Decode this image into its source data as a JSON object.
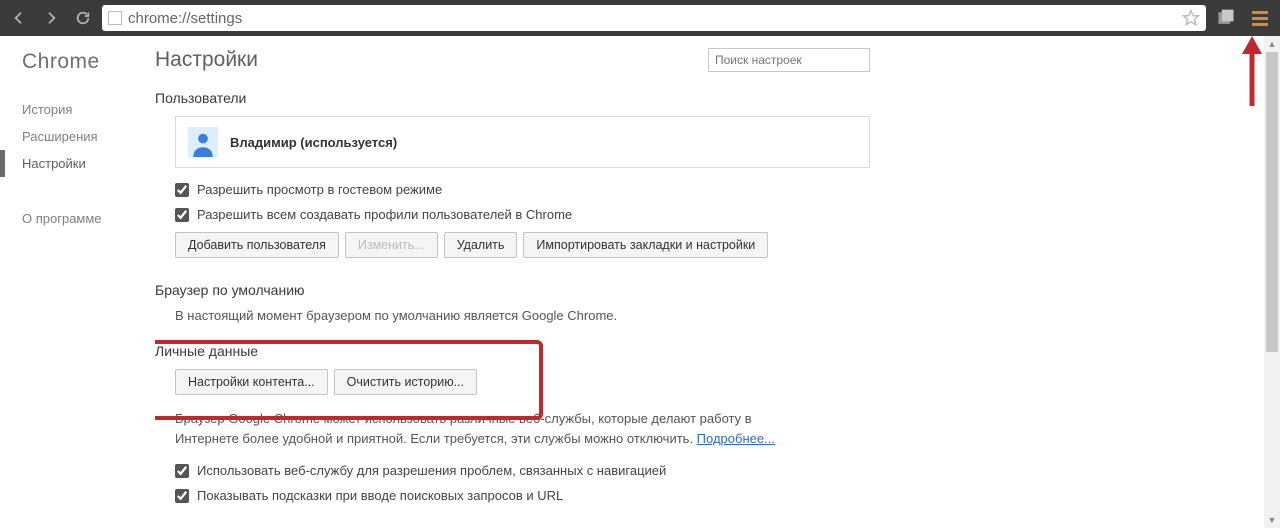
{
  "chrome_bar": {
    "url": "chrome://settings"
  },
  "sidebar": {
    "title": "Chrome",
    "items": [
      {
        "label": "История",
        "active": false
      },
      {
        "label": "Расширения",
        "active": false
      },
      {
        "label": "Настройки",
        "active": true
      }
    ],
    "about": "О программе"
  },
  "header": {
    "title": "Настройки",
    "search_placeholder": "Поиск настроек"
  },
  "users_section": {
    "title": "Пользователи",
    "profile_name": "Владимир (используется)",
    "guest_label": "Разрешить просмотр в гостевом режиме",
    "create_profiles_label": "Разрешить всем создавать профили пользователей в Chrome",
    "add_btn": "Добавить пользователя",
    "edit_btn": "Изменить...",
    "delete_btn": "Удалить",
    "import_btn": "Импортировать закладки и настройки"
  },
  "default_browser": {
    "title": "Браузер по умолчанию",
    "text": "В настоящий момент браузером по умолчанию является Google Chrome."
  },
  "privacy": {
    "title": "Личные данные",
    "content_settings_btn": "Настройки контента...",
    "clear_history_btn": "Очистить историю...",
    "desc_prefix": "Браузер Google Chrome может использовать различные веб-службы, которые делают работу в Интернете более удобной и приятной. Если требуется, эти службы можно отключить. ",
    "learn_more": "Подробнее...",
    "cb_nav": "Использовать веб-службу для разрешения проблем, связанных с навигацией",
    "cb_search": "Показывать подсказки при вводе поисковых запросов и URL"
  }
}
